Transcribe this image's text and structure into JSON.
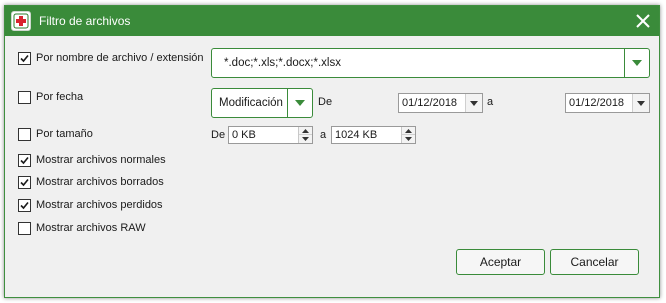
{
  "window": {
    "title": "Filtro de archivos",
    "app_icon": "red-cross-icon",
    "close_icon": "close-icon"
  },
  "colors": {
    "accent": "#3a8b3a",
    "titlebar": "#3a8b3a",
    "background": "#f0f0f0",
    "icon_red": "#d9232e"
  },
  "filters": {
    "by_name": {
      "label": "Por nombre de archivo / extensión",
      "checked": true,
      "pattern": "*.doc;*.xls;*.docx;*.xlsx"
    },
    "by_date": {
      "label": "Por fecha",
      "checked": false,
      "mode": "Modificación",
      "from_label": "De",
      "from": "01/12/2018",
      "to_label": "a",
      "to": "01/12/2018"
    },
    "by_size": {
      "label": "Por tamaño",
      "checked": false,
      "from_label": "De",
      "from": "0 KB",
      "to_label": "a",
      "to": "1024 KB"
    },
    "show_normal": {
      "label": "Mostrar archivos normales",
      "checked": true
    },
    "show_deleted": {
      "label": "Mostrar archivos borrados",
      "checked": true
    },
    "show_lost": {
      "label": "Mostrar archivos perdidos",
      "checked": true
    },
    "show_raw": {
      "label": "Mostrar archivos RAW",
      "checked": false
    }
  },
  "buttons": {
    "accept": "Aceptar",
    "cancel": "Cancelar"
  }
}
